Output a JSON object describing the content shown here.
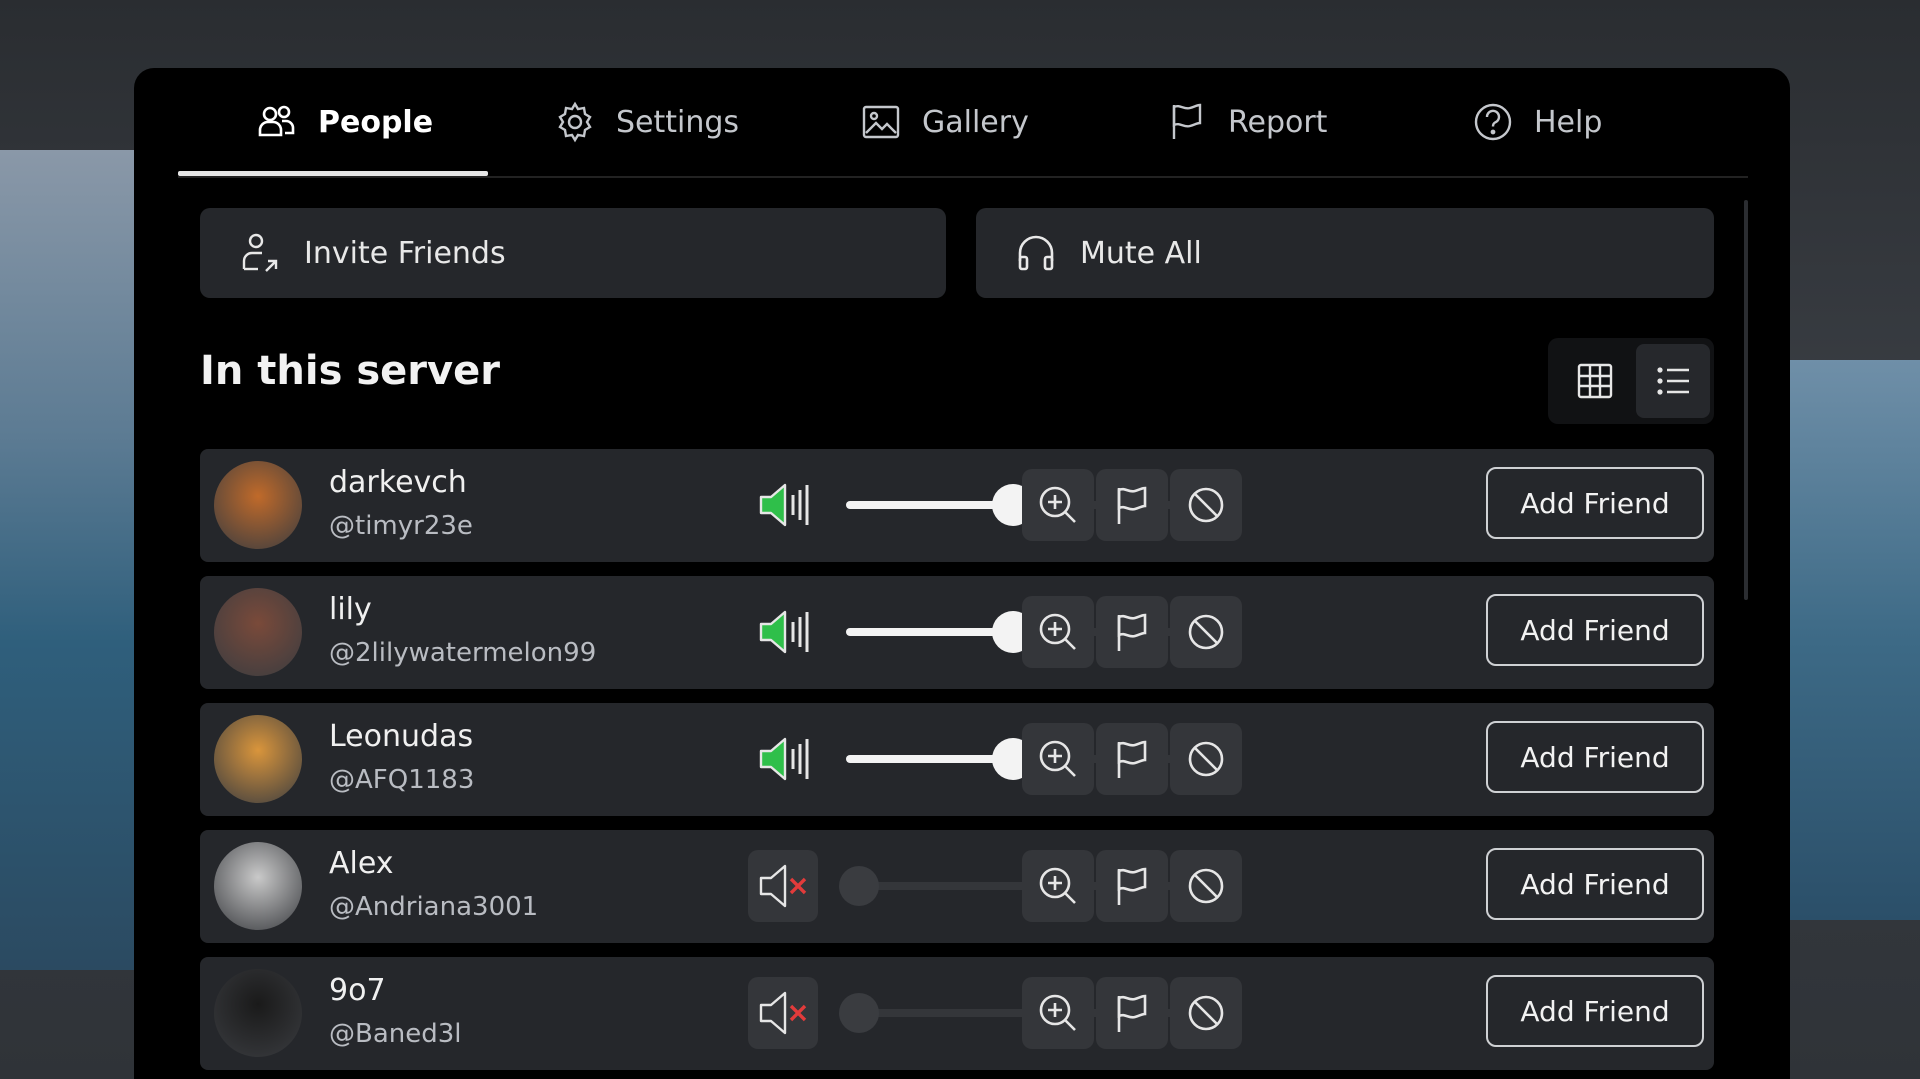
{
  "tabs": [
    {
      "label": "People",
      "icon": "people-icon"
    },
    {
      "label": "Settings",
      "icon": "gear-icon"
    },
    {
      "label": "Gallery",
      "icon": "image-icon"
    },
    {
      "label": "Report",
      "icon": "flag-icon"
    },
    {
      "label": "Help",
      "icon": "help-icon"
    }
  ],
  "actions": {
    "invite_label": "Invite Friends",
    "mute_all_label": "Mute All"
  },
  "section": {
    "title": "In this server"
  },
  "players": [
    {
      "name": "darkevch",
      "handle": "@timyr23e",
      "muted": false,
      "volume": 0.5,
      "add_label": "Add Friend",
      "avatar_color": "#c06a2a"
    },
    {
      "name": "lily",
      "handle": "@2lilywatermelon99",
      "muted": false,
      "volume": 0.5,
      "add_label": "Add Friend",
      "avatar_color": "#7a4a3a"
    },
    {
      "name": "Leonudas",
      "handle": "@AFQ1183",
      "muted": false,
      "volume": 0.5,
      "add_label": "Add Friend",
      "avatar_color": "#d9953c"
    },
    {
      "name": "Alex",
      "handle": "@Andriana3001",
      "muted": true,
      "volume": 0,
      "add_label": "Add Friend",
      "avatar_color": "#c9c9c9"
    },
    {
      "name": "9o7",
      "handle": "@Baned3l",
      "muted": true,
      "volume": 0,
      "add_label": "Add Friend",
      "avatar_color": "#1a1a1a"
    }
  ],
  "colors": {
    "speaker_active": "#2fbf4a",
    "mute_x": "#e23b3b",
    "row_bg": "#25272b"
  }
}
